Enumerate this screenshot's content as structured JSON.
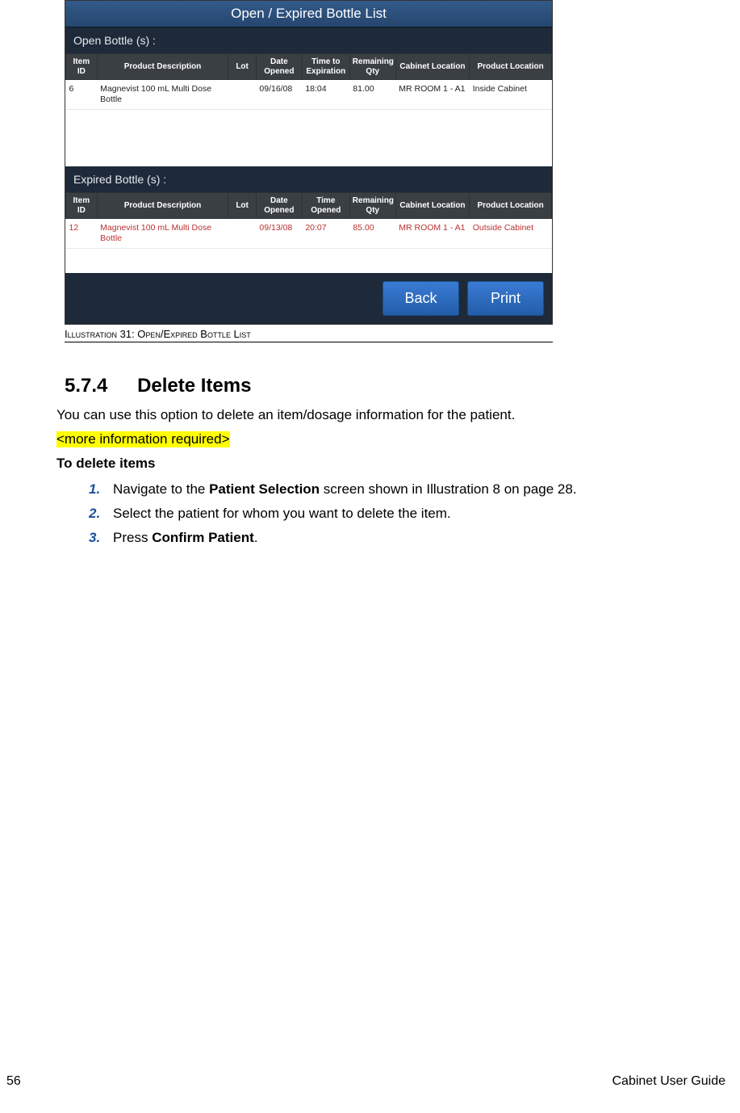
{
  "screenshot": {
    "title": "Open / Expired Bottle List",
    "open_label": "Open Bottle (s) :",
    "expired_label": "Expired Bottle (s) :",
    "open_table": {
      "headers": [
        "Item ID",
        "Product Description",
        "Lot",
        "Date Opened",
        "Time to Expiration",
        "Remaining Qty",
        "Cabinet Location",
        "Product Location"
      ],
      "rows": [
        {
          "item_id": "6",
          "desc": "Magnevist 100 mL Multi Dose Bottle",
          "lot": "",
          "date": "09/16/08",
          "time": "18:04",
          "qty": "81.00",
          "cab": "MR ROOM 1 - A1",
          "prod": "Inside Cabinet"
        }
      ]
    },
    "expired_table": {
      "headers": [
        "Item ID",
        "Product Description",
        "Lot",
        "Date Opened",
        "Time Opened",
        "Remaining Qty",
        "Cabinet Location",
        "Product Location"
      ],
      "rows": [
        {
          "item_id": "12",
          "desc": "Magnevist 100 mL Multi Dose Bottle",
          "lot": "",
          "date": "09/13/08",
          "time": "20:07",
          "qty": "85.00",
          "cab": "MR ROOM 1 - A1",
          "prod": "Outside Cabinet"
        }
      ]
    },
    "back_label": "Back",
    "print_label": "Print"
  },
  "caption": "Illustration 31: Open/Expired Bottle List",
  "heading": {
    "num": "5.7.4",
    "title": "Delete Items"
  },
  "intro": "You can use this option to delete an item/dosage information for the patient.",
  "highlight": "<more information required>",
  "subheading": "To delete items",
  "steps": [
    {
      "n": "1.",
      "pre": "Navigate to the ",
      "bold": "Patient Selection",
      "post": " screen shown in Illustration 8 on page 28."
    },
    {
      "n": "2.",
      "pre": "Select the patient for whom you want to delete the item.",
      "bold": "",
      "post": ""
    },
    {
      "n": "3.",
      "pre": "Press ",
      "bold": "Confirm Patient",
      "post": "."
    }
  ],
  "footer": {
    "page": "56",
    "title": "Cabinet User Guide"
  }
}
